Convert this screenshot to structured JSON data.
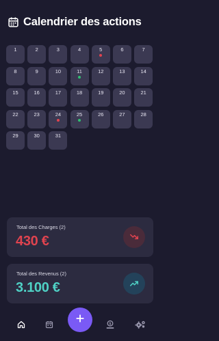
{
  "header": {
    "title": "Calendrier des actions",
    "icon": "calendar-icon"
  },
  "calendar": {
    "days": [
      {
        "n": "1"
      },
      {
        "n": "2"
      },
      {
        "n": "3"
      },
      {
        "n": "4"
      },
      {
        "n": "5",
        "dot": "red"
      },
      {
        "n": "6"
      },
      {
        "n": "7"
      },
      {
        "n": "8"
      },
      {
        "n": "9"
      },
      {
        "n": "10"
      },
      {
        "n": "11",
        "dot": "green"
      },
      {
        "n": "12"
      },
      {
        "n": "13"
      },
      {
        "n": "14"
      },
      {
        "n": "15"
      },
      {
        "n": "16"
      },
      {
        "n": "17"
      },
      {
        "n": "18"
      },
      {
        "n": "19"
      },
      {
        "n": "20"
      },
      {
        "n": "21"
      },
      {
        "n": "22"
      },
      {
        "n": "23"
      },
      {
        "n": "24",
        "dot": "red"
      },
      {
        "n": "25",
        "dot": "green"
      },
      {
        "n": "26"
      },
      {
        "n": "27"
      },
      {
        "n": "28"
      },
      {
        "n": "29"
      },
      {
        "n": "30"
      },
      {
        "n": "31"
      }
    ],
    "dot_colors": {
      "red": "#e0434f",
      "green": "#2fbf71"
    }
  },
  "charges": {
    "label": "Total des Charges (2)",
    "amount": "430 €",
    "color": "#e0434f",
    "badge_bg": "#4a2b3a",
    "icon": "trend-down-icon"
  },
  "revenus": {
    "label": "Total des Revenus (2)",
    "amount": "3.100 €",
    "color": "#4fd1c5",
    "badge_bg": "#23425a",
    "icon": "trend-up-icon"
  },
  "nav": {
    "items": [
      "home-icon",
      "calendar-icon",
      "add-icon",
      "money-icon",
      "settings-icon"
    ],
    "accent": "#7a5af5"
  }
}
